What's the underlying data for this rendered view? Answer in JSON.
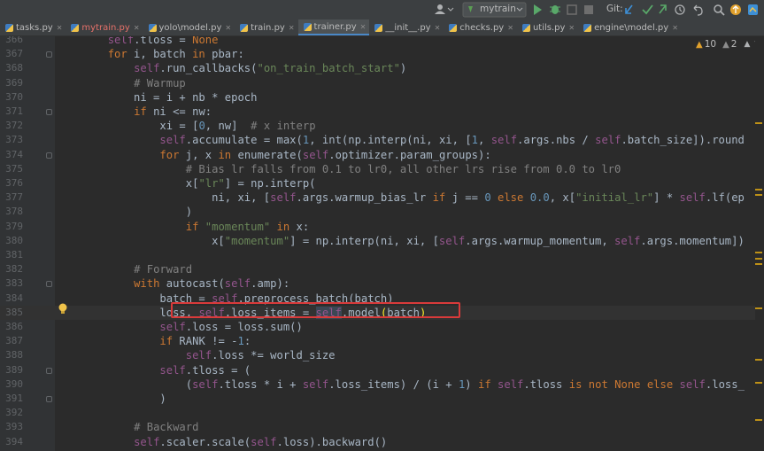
{
  "toolbar": {
    "run_config": "mytrain",
    "git_label": "Git:"
  },
  "tabs": [
    {
      "name": "tasks.py",
      "modified": false,
      "active": false
    },
    {
      "name": "mytrain.py",
      "modified": true,
      "active": false
    },
    {
      "name": "yolo\\model.py",
      "modified": false,
      "active": false
    },
    {
      "name": "train.py",
      "modified": false,
      "active": false
    },
    {
      "name": "trainer.py",
      "modified": false,
      "active": true
    },
    {
      "name": "__init__.py",
      "modified": false,
      "active": false
    },
    {
      "name": "checks.py",
      "modified": false,
      "active": false
    },
    {
      "name": "utils.py",
      "modified": false,
      "active": false
    },
    {
      "name": "engine\\model.py",
      "modified": false,
      "active": false
    }
  ],
  "inspections": {
    "warnings": "10",
    "weak_warnings": "2"
  },
  "editor": {
    "current_line": 385,
    "lines": [
      {
        "n": "366",
        "code": "        self.tloss = None"
      },
      {
        "n": "367",
        "code": "        for i, batch in pbar:"
      },
      {
        "n": "368",
        "code": "            self.run_callbacks(\"on_train_batch_start\")"
      },
      {
        "n": "369",
        "code": "            # Warmup"
      },
      {
        "n": "370",
        "code": "            ni = i + nb * epoch"
      },
      {
        "n": "371",
        "code": "            if ni <= nw:"
      },
      {
        "n": "372",
        "code": "                xi = [0, nw]  # x interp"
      },
      {
        "n": "373",
        "code": "                self.accumulate = max(1, int(np.interp(ni, xi, [1, self.args.nbs / self.batch_size]).round"
      },
      {
        "n": "374",
        "code": "                for j, x in enumerate(self.optimizer.param_groups):"
      },
      {
        "n": "375",
        "code": "                    # Bias lr falls from 0.1 to lr0, all other lrs rise from 0.0 to lr0"
      },
      {
        "n": "376",
        "code": "                    x[\"lr\"] = np.interp("
      },
      {
        "n": "377",
        "code": "                        ni, xi, [self.args.warmup_bias_lr if j == 0 else 0.0, x[\"initial_lr\"] * self.lf(ep"
      },
      {
        "n": "378",
        "code": "                    )"
      },
      {
        "n": "379",
        "code": "                    if \"momentum\" in x:"
      },
      {
        "n": "380",
        "code": "                        x[\"momentum\"] = np.interp(ni, xi, [self.args.warmup_momentum, self.args.momentum])"
      },
      {
        "n": "381",
        "code": ""
      },
      {
        "n": "382",
        "code": "            # Forward"
      },
      {
        "n": "383",
        "code": "            with autocast(self.amp):"
      },
      {
        "n": "384",
        "code": "                batch = self.preprocess_batch(batch)"
      },
      {
        "n": "385",
        "code": "                loss, self.loss_items = self.model(batch)"
      },
      {
        "n": "386",
        "code": "                self.loss = loss.sum()"
      },
      {
        "n": "387",
        "code": "                if RANK != -1:"
      },
      {
        "n": "388",
        "code": "                    self.loss *= world_size"
      },
      {
        "n": "389",
        "code": "                self.tloss = ("
      },
      {
        "n": "390",
        "code": "                    (self.tloss * i + self.loss_items) / (i + 1) if self.tloss is not None else self.loss_"
      },
      {
        "n": "391",
        "code": "                )"
      },
      {
        "n": "392",
        "code": ""
      },
      {
        "n": "393",
        "code": "            # Backward"
      },
      {
        "n": "394",
        "code": "            self.scaler.scale(self.loss).backward()"
      }
    ]
  },
  "colors": {
    "background": "#2b2b2b",
    "keyword": "#cc7832",
    "self": "#94558d",
    "string": "#6a8759",
    "number": "#6897bb",
    "comment": "#808080",
    "annotation_box": "#d93a3a"
  },
  "icons": [
    "user-icon",
    "run-icon",
    "debug-icon",
    "coverage-icon",
    "stop-icon",
    "git-update-icon",
    "git-commit-icon",
    "git-push-icon",
    "history-icon",
    "rollback-icon",
    "search-icon",
    "update-icon",
    "plugin-icon",
    "warning-icon",
    "bulb-icon"
  ]
}
